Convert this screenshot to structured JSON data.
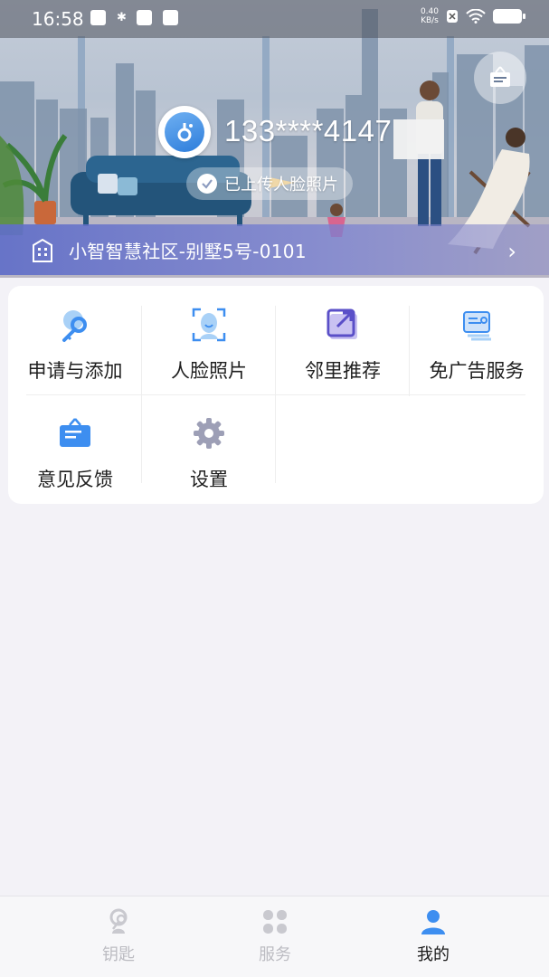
{
  "status_bar": {
    "time": "16:58",
    "net_speed_value": "0.40",
    "net_speed_unit": "KB/s"
  },
  "profile": {
    "phone": "133****4147",
    "face_status": "已上传人脸照片",
    "community": "小智智慧社区-别墅5号-0101"
  },
  "grid": {
    "items": [
      {
        "label": "申请与添加",
        "icon": "key-search-icon"
      },
      {
        "label": "人脸照片",
        "icon": "face-scan-icon"
      },
      {
        "label": "邻里推荐",
        "icon": "share-icon"
      },
      {
        "label": "免广告服务",
        "icon": "ad-free-icon"
      },
      {
        "label": "意见反馈",
        "icon": "feedback-board-icon"
      },
      {
        "label": "设置",
        "icon": "gear-icon"
      }
    ]
  },
  "tabbar": {
    "tabs": [
      {
        "label": "钥匙",
        "icon": "key-icon",
        "active": false
      },
      {
        "label": "服务",
        "icon": "grid-icon",
        "active": false
      },
      {
        "label": "我的",
        "icon": "person-icon",
        "active": true
      }
    ]
  },
  "colors": {
    "accent": "#3d8ef0",
    "page_bg": "#f3f2f7",
    "tab_inactive": "#bcbcc2"
  }
}
